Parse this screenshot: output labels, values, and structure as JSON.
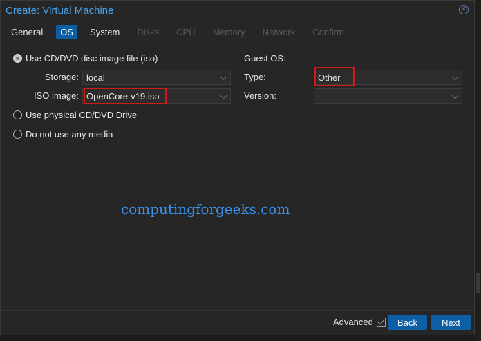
{
  "window": {
    "title": "Create: Virtual Machine"
  },
  "tabs": [
    {
      "label": "General",
      "state": "normal"
    },
    {
      "label": "OS",
      "state": "active"
    },
    {
      "label": "System",
      "state": "normal"
    },
    {
      "label": "Disks",
      "state": "disabled"
    },
    {
      "label": "CPU",
      "state": "disabled"
    },
    {
      "label": "Memory",
      "state": "disabled"
    },
    {
      "label": "Network",
      "state": "disabled"
    },
    {
      "label": "Confirm",
      "state": "disabled"
    }
  ],
  "media": {
    "option_iso": "Use CD/DVD disc image file (iso)",
    "storage_label": "Storage:",
    "storage_value": "local",
    "iso_label": "ISO image:",
    "iso_value": "OpenCore-v19.iso",
    "option_physical": "Use physical CD/DVD Drive",
    "option_none": "Do not use any media",
    "selected": "iso"
  },
  "guest_os": {
    "heading": "Guest OS:",
    "type_label": "Type:",
    "type_value": "Other",
    "version_label": "Version:",
    "version_value": "-"
  },
  "watermark": "computingforgeeks.com",
  "footer": {
    "advanced_label": "Advanced",
    "advanced_checked": true,
    "back_label": "Back",
    "next_label": "Next"
  },
  "colors": {
    "accent": "#0c5fa4",
    "title": "#4aa3ea",
    "highlight": "#d01919",
    "watermark": "#3a8fe6"
  }
}
